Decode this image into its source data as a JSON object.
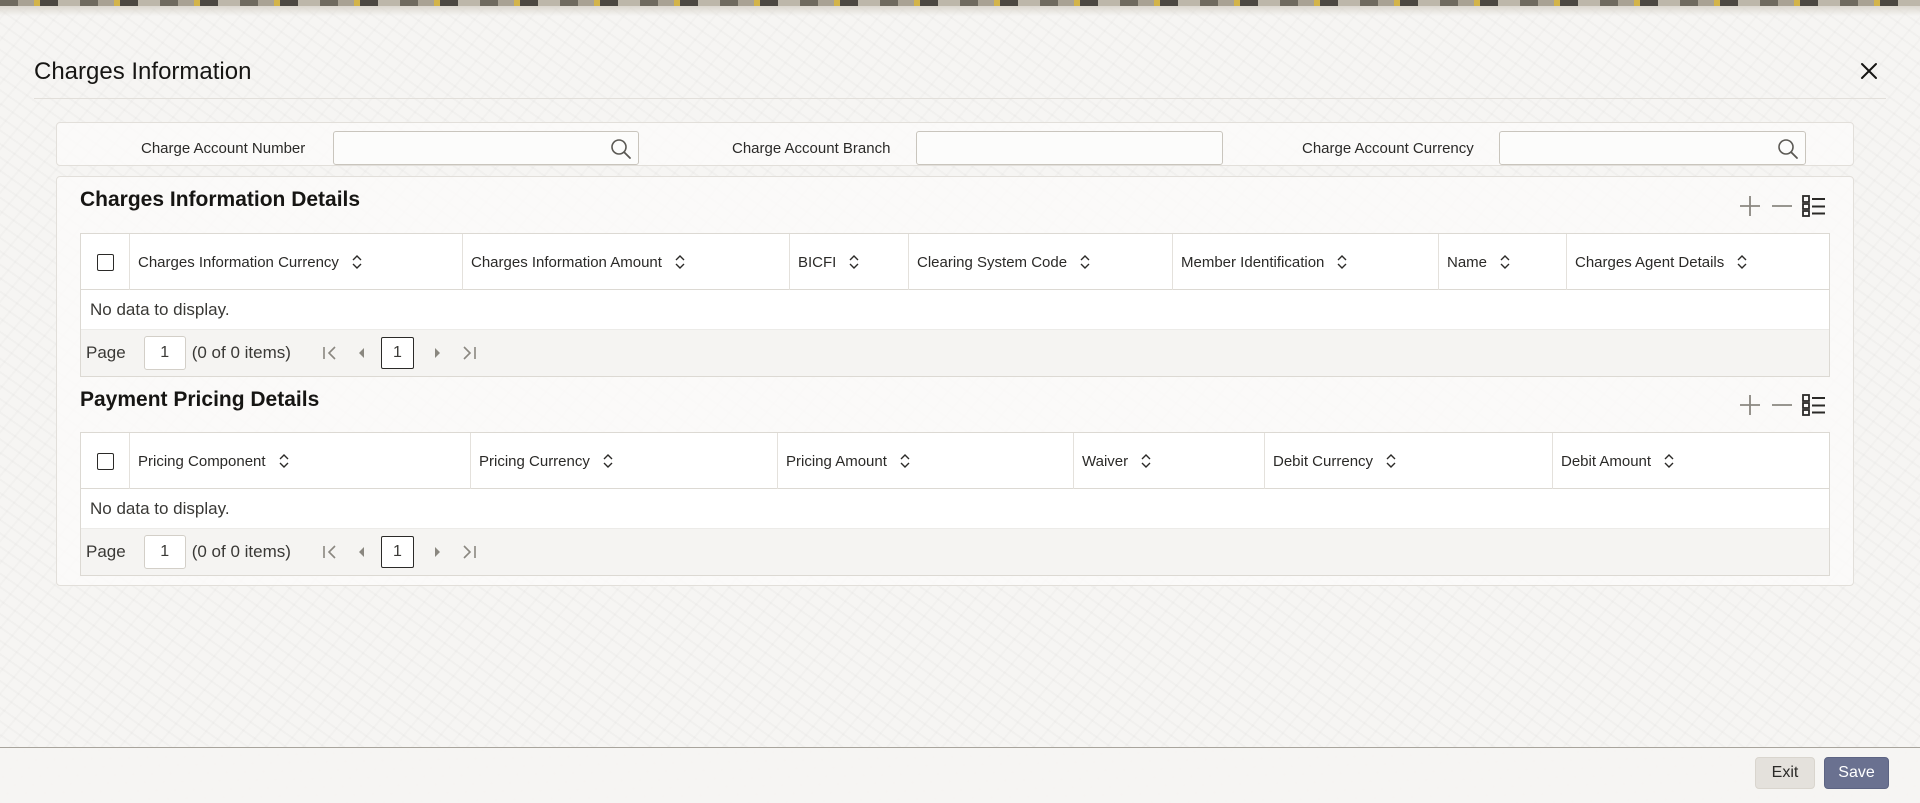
{
  "dialog": {
    "title": "Charges Information",
    "close_icon": "close-icon"
  },
  "header_fields": {
    "charge_account_number": {
      "label": "Charge Account Number",
      "value": "",
      "icon": "search-icon"
    },
    "charge_account_branch": {
      "label": "Charge Account Branch",
      "value": ""
    },
    "charge_account_currency": {
      "label": "Charge Account Currency",
      "value": "",
      "icon": "search-icon"
    }
  },
  "charges_information_details": {
    "title": "Charges Information Details",
    "toolbar_icons": [
      "add-row-icon",
      "delete-row-icon",
      "view-details-icon"
    ],
    "columns": [
      "Charges Information Currency",
      "Charges Information Amount",
      "BICFI",
      "Clearing System Code",
      "Member Identification",
      "Name",
      "Charges Agent Details"
    ],
    "empty_message": "No data to display.",
    "pager": {
      "page_label": "Page",
      "page_value": "1",
      "items_text": "(0 of 0 items)",
      "current_page": "1"
    }
  },
  "payment_pricing_details": {
    "title": "Payment Pricing Details",
    "toolbar_icons": [
      "add-row-icon",
      "delete-row-icon",
      "view-details-icon"
    ],
    "columns": [
      "Pricing Component",
      "Pricing Currency",
      "Pricing Amount",
      "Waiver",
      "Debit Currency",
      "Debit Amount"
    ],
    "empty_message": "No data to display.",
    "pager": {
      "page_label": "Page",
      "page_value": "1",
      "items_text": "(0 of 0 items)",
      "current_page": "1"
    }
  },
  "footer": {
    "exit_label": "Exit",
    "save_label": "Save"
  },
  "colors": {
    "save_button": "#6a7190",
    "exit_button": "#e4e1dc",
    "text": "#161513"
  }
}
